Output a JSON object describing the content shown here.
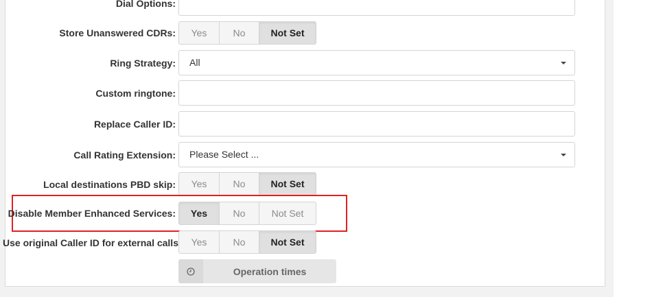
{
  "form": {
    "dial_options": {
      "label": "Dial Options:",
      "value": ""
    },
    "store_unanswered_cdrs": {
      "label": "Store Unanswered CDRs:",
      "options": [
        "Yes",
        "No",
        "Not Set"
      ],
      "selected": "Not Set"
    },
    "ring_strategy": {
      "label": "Ring Strategy:",
      "value": "All"
    },
    "custom_ringtone": {
      "label": "Custom ringtone:",
      "value": ""
    },
    "replace_caller_id": {
      "label": "Replace Caller ID:",
      "value": ""
    },
    "call_rating_extension": {
      "label": "Call Rating Extension:",
      "value": "Please Select ..."
    },
    "local_destinations_pbd_skip": {
      "label": "Local destinations PBD skip:",
      "options": [
        "Yes",
        "No",
        "Not Set"
      ],
      "selected": "Not Set"
    },
    "disable_member_enhanced_services": {
      "label": "Disable Member Enhanced Services:",
      "options": [
        "Yes",
        "No",
        "Not Set"
      ],
      "selected": "Yes"
    },
    "use_original_caller_id": {
      "label": "Use original Caller ID for external calls:",
      "options": [
        "Yes",
        "No",
        "Not Set"
      ],
      "selected": "Not Set"
    }
  },
  "operation_times_button": {
    "label": "Operation times",
    "icon": "clock-icon"
  },
  "colors": {
    "highlight": "#e02020",
    "panel_bg": "#ffffff",
    "page_bg": "#f2f2f2"
  }
}
